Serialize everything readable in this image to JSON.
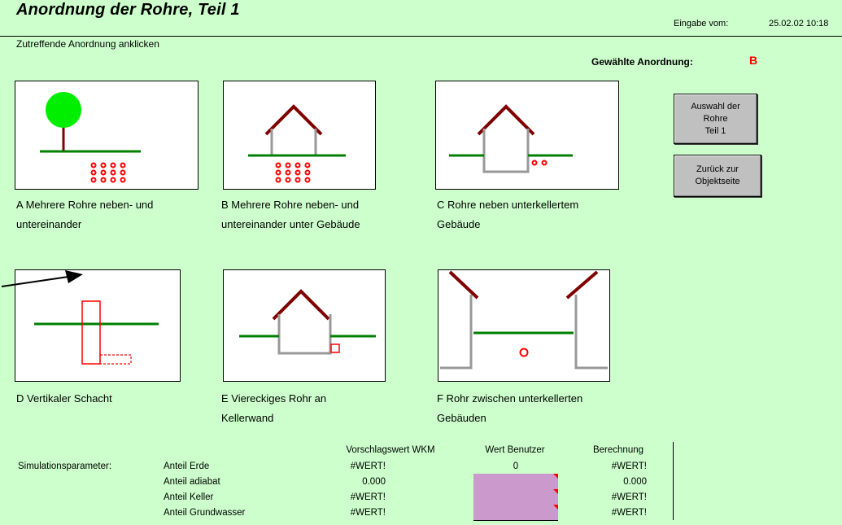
{
  "header": {
    "title": "Anordnung der Rohre, Teil 1",
    "eingabe_label": "Eingabe vom:",
    "eingabe_value": "25.02.02 10:18"
  },
  "instruction": "Zutreffende Anordnung anklicken",
  "selection": {
    "label": "Gewählte Anordnung:",
    "value": "B",
    "value_color": "#ff0000"
  },
  "options": [
    {
      "id": "A",
      "line1": "A  Mehrere Rohre neben- und",
      "line2": "untereinander"
    },
    {
      "id": "B",
      "line1": "B  Mehrere Rohre neben- und",
      "line2": "untereinander unter Gebäude"
    },
    {
      "id": "C",
      "line1": "C  Rohre neben unterkellertem",
      "line2": "Gebäude"
    },
    {
      "id": "D",
      "line1": "D  Vertikaler Schacht",
      "line2": ""
    },
    {
      "id": "E",
      "line1": "E  Viereckiges Rohr an",
      "line2": "Kellerwand"
    },
    {
      "id": "F",
      "line1": "F  Rohr zwischen unterkellerten",
      "line2": "Gebäuden"
    }
  ],
  "buttons": {
    "auswahl": [
      "Auswahl der",
      "Rohre",
      "Teil 1"
    ],
    "zurueck": [
      "Zurück zur",
      "Objektseite"
    ]
  },
  "simulation": {
    "label": "Simulationsparameter:",
    "headers": {
      "vorschlag": "Vorschlagswert WKM",
      "benutzer": "Wert Benutzer",
      "berechnung": "Berechnung"
    },
    "rows": [
      {
        "name": "Anteil Erde",
        "vorschlag": "#WERT!",
        "benutzer": "0",
        "berechnung": "#WERT!"
      },
      {
        "name": "Anteil adiabat",
        "vorschlag": "0.000",
        "benutzer": "",
        "berechnung": "0.000"
      },
      {
        "name": "Anteil Keller",
        "vorschlag": "#WERT!",
        "benutzer": "",
        "berechnung": "#WERT!"
      },
      {
        "name": "Anteil Grundwasser",
        "vorschlag": "#WERT!",
        "benutzer": "",
        "berechnung": "#WERT!"
      }
    ]
  },
  "colors": {
    "background": "#ccffcc",
    "ground": "#007f00",
    "roof": "#7f0000",
    "pipe": "#ff0000",
    "wall": "#999999",
    "tree": "#00ee00",
    "input": "#cc99cc"
  }
}
